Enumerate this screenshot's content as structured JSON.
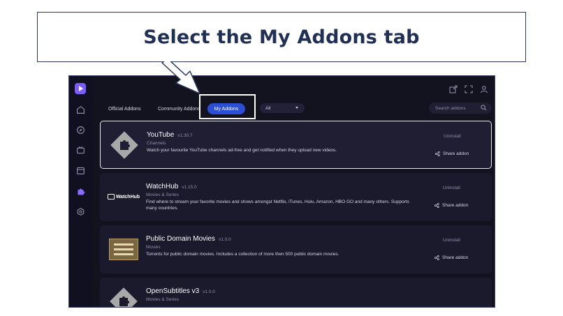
{
  "callout": {
    "text": "Select the My Addons tab"
  },
  "tabs": [
    {
      "label": "Official Addons"
    },
    {
      "label": "Community Addons"
    },
    {
      "label": "My Addons",
      "active": true
    }
  ],
  "filter": {
    "selected": "All"
  },
  "search": {
    "placeholder": "Search addons"
  },
  "sidebar_icons": [
    "home-icon",
    "compass-icon",
    "tv-icon",
    "calendar-icon",
    "puzzle-icon",
    "settings-icon"
  ],
  "topbar_icons": [
    "external-link-icon",
    "fullscreen-icon",
    "user-icon"
  ],
  "colors": {
    "accent": "#2a4fd6",
    "logo": "#7b5cff",
    "background": "#13121f",
    "callout_text": "#1f2f55"
  },
  "addons": [
    {
      "title": "YouTube",
      "version": "v1.30.7",
      "type": "Channels",
      "description": "Watch your favourite YouTube channels ad-free and get notified when they upload new videos.",
      "uninstall": "Uninstall",
      "share": "Share addon",
      "logo": "puzzle-icon"
    },
    {
      "title": "WatchHub",
      "version": "v1.15.0",
      "type": "Movies & Series",
      "description": "Find where to stream your favorite movies and shows amongst Netflix, iTunes, Hulu, Amazon, HBO GO and many others. Supports many countries.",
      "uninstall": "Uninstall",
      "share": "Share addon",
      "logo_text": "WatchHub"
    },
    {
      "title": "Public Domain Movies",
      "version": "v1.0.0",
      "type": "Movies",
      "description": "Torrents for public domain movies. Includes a collection of more then 500 public domain movies.",
      "uninstall": "Uninstall",
      "share": "Share addon",
      "logo": "film-poster-icon"
    },
    {
      "title": "OpenSubtitles v3",
      "version": "v1.0.0",
      "type": "Movies & Series",
      "description": "",
      "uninstall": "",
      "share": "",
      "logo": "puzzle-icon"
    }
  ]
}
